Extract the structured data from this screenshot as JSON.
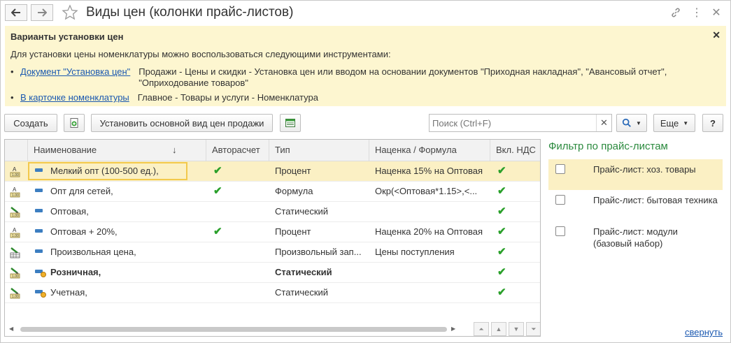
{
  "window": {
    "title": "Виды цен (колонки прайс-листов)"
  },
  "info_panel": {
    "title": "Варианты установки цен",
    "intro": "Для установки цены номенклатуры можно воспользоваться следующими инструментами:",
    "items": [
      {
        "link": "Документ \"Установка цен\"",
        "desc_line1": "Продажи - Цены и скидки - Установка цен или вводом на  основании документов \"Приходная накладная\", \"Авансовый отчет\",",
        "desc_line2": "\"Оприходование товаров\""
      },
      {
        "link": "В карточке номенклатуры",
        "desc_line1": "Главное - Товары и услуги - Номенклатура",
        "desc_line2": ""
      }
    ]
  },
  "toolbar": {
    "create_label": "Создать",
    "set_default_label": "Установить основной вид цен продажи",
    "search_placeholder": "Поиск (Ctrl+F)",
    "more_label": "Еще",
    "help_label": "?"
  },
  "table": {
    "columns": [
      "Наименование",
      "Авторасчет",
      "Тип",
      "Наценка / Формула",
      "Вкл. НДС"
    ],
    "sort_indicator": "↓",
    "rows": [
      {
        "name": "Мелкий опт (100-500 ед.),",
        "auto": true,
        "type": "Процент",
        "formula": "Наценка 15% на Оптовая",
        "vat": true,
        "bold": false,
        "icon": "percent-price-icon"
      },
      {
        "name": "Опт для сетей,",
        "auto": true,
        "type": "Формула",
        "formula": "Окр(<Оптовая*1.15>,<...",
        "vat": true,
        "bold": false,
        "icon": "formula-price-icon"
      },
      {
        "name": "Оптовая,",
        "auto": false,
        "type": "Статический",
        "formula": "",
        "vat": true,
        "bold": false,
        "icon": "static-price-icon"
      },
      {
        "name": "Оптовая + 20%,",
        "auto": true,
        "type": "Процент",
        "formula": "Наценка 20% на Оптовая",
        "vat": true,
        "bold": false,
        "icon": "percent-price-icon"
      },
      {
        "name": "Произвольная цена,",
        "auto": false,
        "type": "Произвольный зап...",
        "formula": "Цены поступления",
        "vat": true,
        "bold": false,
        "icon": "arbitrary-price-icon"
      },
      {
        "name": "Розничная,",
        "auto": false,
        "type": "Статический",
        "formula": "",
        "vat": true,
        "bold": true,
        "icon": "static-price-icon"
      },
      {
        "name": "Учетная,",
        "auto": false,
        "type": "Статический",
        "formula": "",
        "vat": true,
        "bold": false,
        "icon": "static-price-icon"
      }
    ]
  },
  "filter_panel": {
    "title": "Фильтр по прайс-листам",
    "items": [
      {
        "label_line1": "Прайс-лист: хоз. товары",
        "label_line2": "",
        "checked": false
      },
      {
        "label_line1": "Прайс-лист: бытовая техника",
        "label_line2": "",
        "checked": false
      },
      {
        "label_line1": "Прайс-лист: модули",
        "label_line2": "(базовый набор)",
        "checked": false
      }
    ],
    "collapse_label": "свернуть"
  },
  "colors": {
    "info_bg": "#fdf6d0",
    "selection": "#fbf0c4",
    "link": "#1a58b0",
    "check": "#2aa02a",
    "filter_title": "#2b8a3e"
  }
}
